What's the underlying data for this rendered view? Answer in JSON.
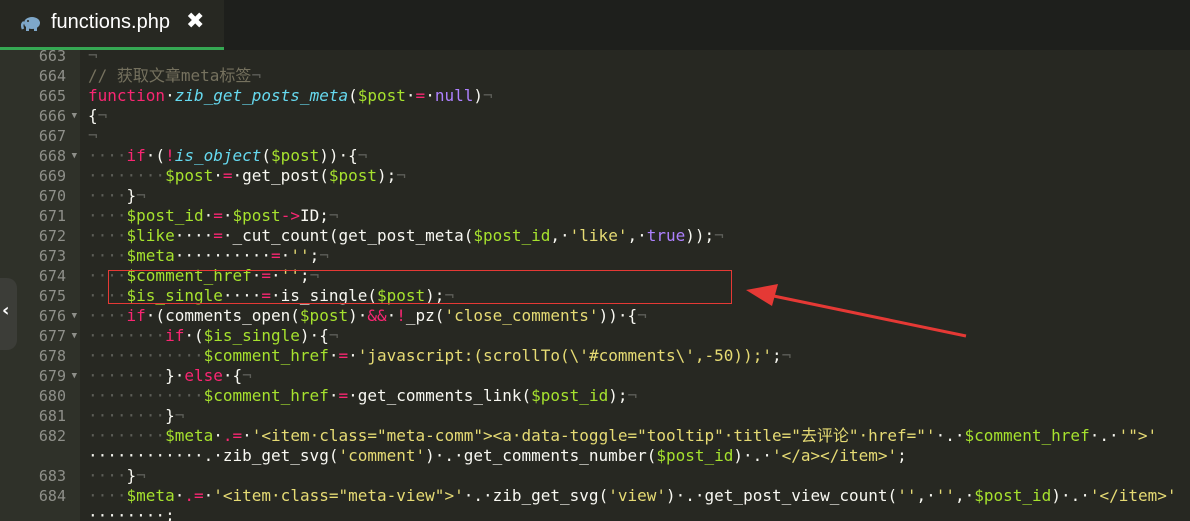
{
  "tab": {
    "filename": "functions.php",
    "close_glyph": "✖"
  },
  "line_numbers": [
    "663",
    "664",
    "665",
    "666",
    "667",
    "668",
    "669",
    "670",
    "671",
    "672",
    "673",
    "674",
    "675",
    "676",
    "677",
    "678",
    "679",
    "680",
    "681",
    "682",
    "",
    "683",
    "684",
    ""
  ],
  "fold_lines": [
    "666",
    "668",
    "676",
    "677",
    "679"
  ],
  "active_line": "672",
  "colors": {
    "keyword": "#f92672",
    "function": "#66d9ef",
    "variable": "#a6e22e",
    "string": "#e6db74",
    "comment": "#75715e",
    "constant": "#ae81ff",
    "annotation": "#e53935"
  },
  "code_lines": [
    [
      [
        "inv",
        "¬"
      ]
    ],
    [
      [
        "cm",
        "// 获取文章meta标签"
      ],
      [
        "inv",
        "¬"
      ]
    ],
    [
      [
        "kw",
        "function"
      ],
      [
        "",
        "·"
      ],
      [
        "fn",
        "zib_get_posts_meta"
      ],
      [
        "",
        "("
      ],
      [
        "var",
        "$post"
      ],
      [
        "",
        "·"
      ],
      [
        "kw",
        "="
      ],
      [
        "",
        "·"
      ],
      [
        "num",
        "null"
      ],
      [
        "",
        ")"
      ],
      [
        "inv",
        "¬"
      ]
    ],
    [
      [
        "",
        "{"
      ],
      [
        "inv",
        "¬"
      ]
    ],
    [
      [
        "inv",
        "¬"
      ]
    ],
    [
      [
        "inv",
        "····"
      ],
      [
        "kw",
        "if"
      ],
      [
        "",
        "·("
      ],
      [
        "kw",
        "!"
      ],
      [
        "fn",
        "is_object"
      ],
      [
        "",
        "("
      ],
      [
        "var",
        "$post"
      ],
      [
        "",
        "))·{"
      ],
      [
        "inv",
        "¬"
      ]
    ],
    [
      [
        "inv",
        "········"
      ],
      [
        "var",
        "$post"
      ],
      [
        "",
        "·"
      ],
      [
        "kw",
        "="
      ],
      [
        "",
        "·get_post("
      ],
      [
        "var",
        "$post"
      ],
      [
        "",
        ");"
      ],
      [
        "inv",
        "¬"
      ]
    ],
    [
      [
        "inv",
        "····"
      ],
      [
        "",
        "}"
      ],
      [
        "inv",
        "¬"
      ]
    ],
    [
      [
        "inv",
        "····"
      ],
      [
        "var",
        "$post_id"
      ],
      [
        "",
        "·"
      ],
      [
        "kw",
        "="
      ],
      [
        "",
        "·"
      ],
      [
        "var",
        "$post"
      ],
      [
        "kw",
        "->"
      ],
      [
        "",
        "ID;"
      ],
      [
        "inv",
        "¬"
      ]
    ],
    [
      [
        "inv",
        "····"
      ],
      [
        "var",
        "$like"
      ],
      [
        "",
        "····"
      ],
      [
        "kw",
        "="
      ],
      [
        "",
        "·_cut_count(get_post_meta("
      ],
      [
        "var",
        "$post_id"
      ],
      [
        "",
        ",·"
      ],
      [
        "str",
        "'like'"
      ],
      [
        "",
        ",·"
      ],
      [
        "num",
        "true"
      ],
      [
        "",
        "));"
      ],
      [
        "inv",
        "¬"
      ]
    ],
    [
      [
        "inv",
        "····"
      ],
      [
        "var",
        "$meta"
      ],
      [
        "",
        "··········"
      ],
      [
        "kw",
        "="
      ],
      [
        "",
        "·"
      ],
      [
        "str",
        "''"
      ],
      [
        "",
        ";"
      ],
      [
        "inv",
        "¬"
      ]
    ],
    [
      [
        "inv",
        "····"
      ],
      [
        "var",
        "$comment_href"
      ],
      [
        "",
        "·"
      ],
      [
        "kw",
        "="
      ],
      [
        "",
        "·"
      ],
      [
        "str",
        "''"
      ],
      [
        "",
        ";"
      ],
      [
        "inv",
        "¬"
      ]
    ],
    [
      [
        "inv",
        "····"
      ],
      [
        "var",
        "$is_single"
      ],
      [
        "",
        "····"
      ],
      [
        "kw",
        "="
      ],
      [
        "",
        "·is_single("
      ],
      [
        "var",
        "$post"
      ],
      [
        "",
        ");"
      ],
      [
        "inv",
        "¬"
      ]
    ],
    [
      [
        "inv",
        "····"
      ],
      [
        "kw",
        "if"
      ],
      [
        "",
        "·(comments_open("
      ],
      [
        "var",
        "$post"
      ],
      [
        "",
        ")·"
      ],
      [
        "kw",
        "&&"
      ],
      [
        "",
        "·"
      ],
      [
        "kw",
        "!"
      ],
      [
        "",
        "_pz("
      ],
      [
        "str",
        "'close_comments'"
      ],
      [
        "",
        "))·{"
      ],
      [
        "inv",
        "¬"
      ]
    ],
    [
      [
        "inv",
        "········"
      ],
      [
        "kw",
        "if"
      ],
      [
        "",
        "·("
      ],
      [
        "var",
        "$is_single"
      ],
      [
        "",
        ")·{"
      ],
      [
        "inv",
        "¬"
      ]
    ],
    [
      [
        "inv",
        "············"
      ],
      [
        "var",
        "$comment_href"
      ],
      [
        "",
        "·"
      ],
      [
        "kw",
        "="
      ],
      [
        "",
        "·"
      ],
      [
        "str",
        "'javascript:(scrollTo(\\'#comments\\',-50));'"
      ],
      [
        "",
        ";"
      ],
      [
        "inv",
        "¬"
      ]
    ],
    [
      [
        "inv",
        "········"
      ],
      [
        "",
        "}·"
      ],
      [
        "kw",
        "else"
      ],
      [
        "",
        "·{"
      ],
      [
        "inv",
        "¬"
      ]
    ],
    [
      [
        "inv",
        "············"
      ],
      [
        "var",
        "$comment_href"
      ],
      [
        "",
        "·"
      ],
      [
        "kw",
        "="
      ],
      [
        "",
        "·get_comments_link("
      ],
      [
        "var",
        "$post_id"
      ],
      [
        "",
        ");"
      ],
      [
        "inv",
        "¬"
      ]
    ],
    [
      [
        "inv",
        "········"
      ],
      [
        "",
        "}"
      ],
      [
        "inv",
        "¬"
      ]
    ],
    [
      [
        "inv",
        "········"
      ],
      [
        "var",
        "$meta"
      ],
      [
        "",
        "·"
      ],
      [
        "kw",
        ".="
      ],
      [
        "",
        "·"
      ],
      [
        "str",
        "'<item·class=\"meta-comm\"><a·data-toggle=\"tooltip\"·title=\"去评论\"·href=\"'"
      ],
      [
        "",
        "·.·"
      ],
      [
        "var",
        "$comment_href"
      ],
      [
        "",
        "·.·"
      ],
      [
        "str",
        "'\">'"
      ]
    ],
    [
      [
        "",
        "············.·zib_get_svg("
      ],
      [
        "str",
        "'comment'"
      ],
      [
        "",
        ")·.·get_comments_number("
      ],
      [
        "var",
        "$post_id"
      ],
      [
        "",
        ")·.·"
      ],
      [
        "str",
        "'</a></item>'"
      ],
      [
        "",
        ";"
      ]
    ],
    [
      [
        "inv",
        "····"
      ],
      [
        "",
        "}"
      ],
      [
        "inv",
        "¬"
      ]
    ],
    [
      [
        "inv",
        "····"
      ],
      [
        "var",
        "$meta"
      ],
      [
        "",
        "·"
      ],
      [
        "kw",
        ".="
      ],
      [
        "",
        "·"
      ],
      [
        "str",
        "'<item·class=\"meta-view\">'"
      ],
      [
        "",
        "·.·zib_get_svg("
      ],
      [
        "str",
        "'view'"
      ],
      [
        "",
        ")·.·get_post_view_count("
      ],
      [
        "str",
        "''"
      ],
      [
        "",
        ",·"
      ],
      [
        "str",
        "''"
      ],
      [
        "",
        ",·"
      ],
      [
        "var",
        "$post_id"
      ],
      [
        "",
        ")·.·"
      ],
      [
        "str",
        "'</item>'"
      ]
    ],
    [
      [
        "",
        "········;"
      ]
    ]
  ]
}
